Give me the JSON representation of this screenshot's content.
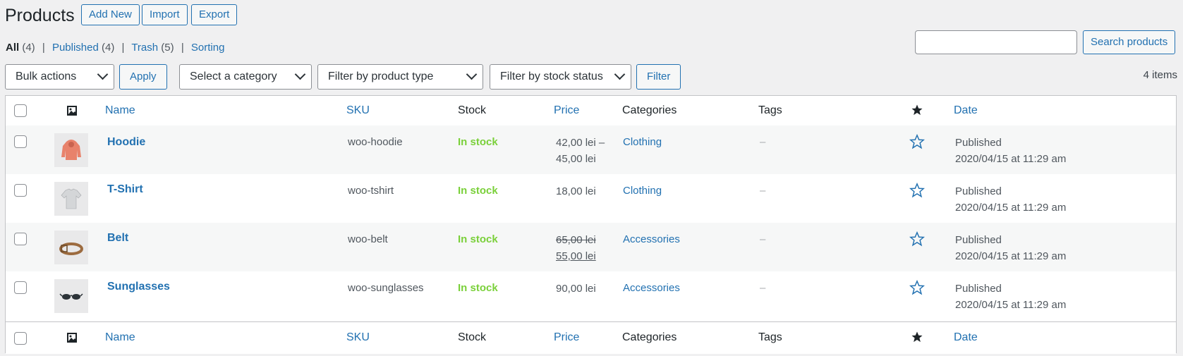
{
  "header": {
    "title": "Products",
    "add_new": "Add New",
    "import": "Import",
    "export": "Export"
  },
  "views": {
    "all": "All",
    "all_count": "(4)",
    "published": "Published",
    "published_count": "(4)",
    "trash": "Trash",
    "trash_count": "(5)",
    "sorting": "Sorting",
    "separator": "|"
  },
  "search": {
    "value": "",
    "button": "Search products"
  },
  "filters": {
    "bulk_actions": "Bulk actions",
    "apply": "Apply",
    "category": "Select a category",
    "product_type": "Filter by product type",
    "stock_status": "Filter by stock status",
    "filter": "Filter",
    "items_count": "4 items"
  },
  "columns": {
    "name": "Name",
    "sku": "SKU",
    "stock": "Stock",
    "price": "Price",
    "categories": "Categories",
    "tags": "Tags",
    "date": "Date"
  },
  "rows": [
    {
      "name": "Hoodie",
      "sku": "woo-hoodie",
      "stock": "In stock",
      "price1": "42,00 lei –",
      "price2": "45,00 lei",
      "category": "Clothing",
      "tags": "–",
      "status": "Published",
      "date": "2020/04/15 at 11:29 am",
      "thumb": "hoodie-image"
    },
    {
      "name": "T-Shirt",
      "sku": "woo-tshirt",
      "stock": "In stock",
      "price1": "18,00 lei",
      "category": "Clothing",
      "tags": "–",
      "status": "Published",
      "date": "2020/04/15 at 11:29 am",
      "thumb": "tshirt-image"
    },
    {
      "name": "Belt",
      "sku": "woo-belt",
      "stock": "In stock",
      "price_regular": "65,00 lei",
      "price_sale": "55,00 lei",
      "category": "Accessories",
      "tags": "–",
      "status": "Published",
      "date": "2020/04/15 at 11:29 am",
      "thumb": "belt-image"
    },
    {
      "name": "Sunglasses",
      "sku": "woo-sunglasses",
      "stock": "In stock",
      "price1": "90,00 lei",
      "category": "Accessories",
      "tags": "–",
      "status": "Published",
      "date": "2020/04/15 at 11:29 am",
      "thumb": "sunglasses-image"
    }
  ],
  "colors": {
    "link": "#2271b1",
    "in_stock": "#7ad03a",
    "background": "#f0f0f1"
  }
}
